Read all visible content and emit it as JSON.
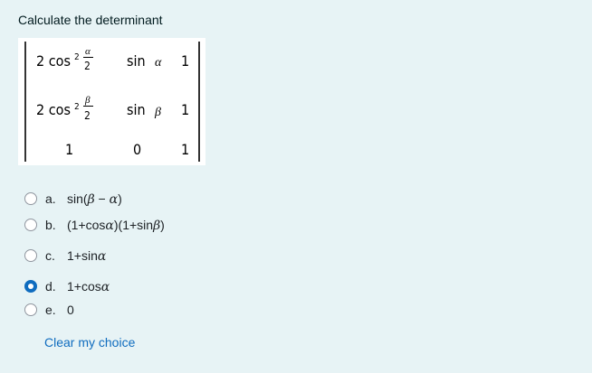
{
  "question": {
    "text": "Calculate the determinant"
  },
  "matrix": {
    "rows": [
      [
        "2 cos²(α/2)",
        "sin α",
        "1"
      ],
      [
        "2 cos²(β/2)",
        "sin β",
        "1"
      ],
      [
        "1",
        "0",
        "1"
      ]
    ]
  },
  "answers": [
    {
      "letter": "a.",
      "text": "sin(β − α)",
      "selected": false
    },
    {
      "letter": "b.",
      "text": "(1+cosα)(1+sinβ)",
      "selected": false
    },
    {
      "letter": "c.",
      "text": "1+sinα",
      "selected": false
    },
    {
      "letter": "d.",
      "text": "1+cosα",
      "selected": true
    },
    {
      "letter": "e.",
      "text": "0",
      "selected": false
    }
  ],
  "clear_choice_label": "Clear my choice",
  "colors": {
    "background": "#e7f3f5",
    "accent": "#0f6cbf",
    "text": "#1d2125"
  }
}
